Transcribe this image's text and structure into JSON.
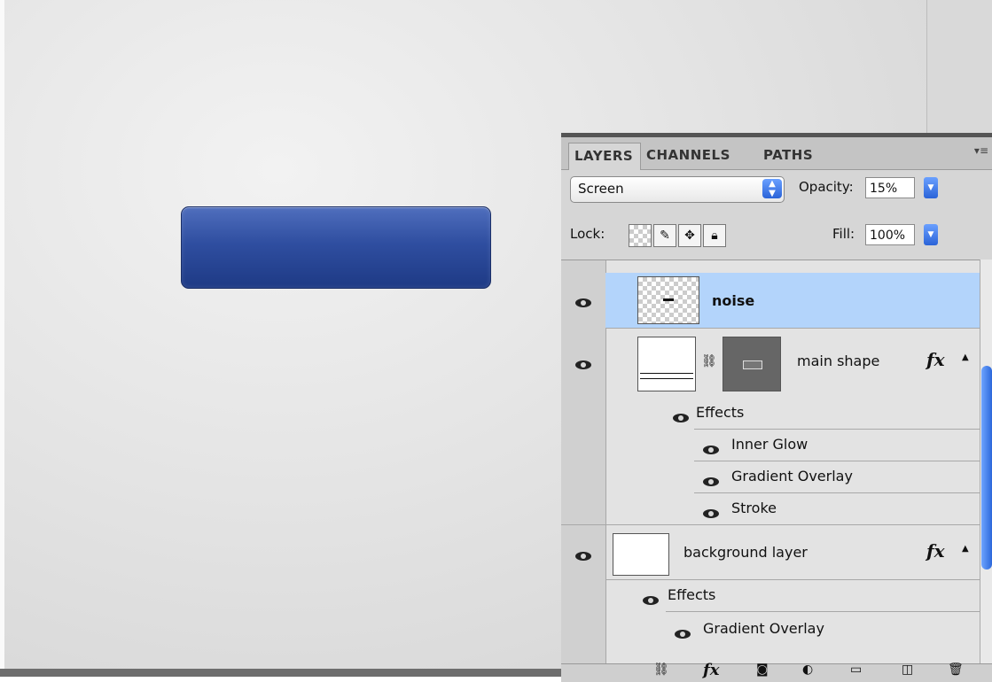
{
  "canvas": {
    "button_color": "#2f4ea0"
  },
  "layers_panel": {
    "tabs": [
      {
        "label": "LAYERS",
        "active": true
      },
      {
        "label": "CHANNELS",
        "active": false
      },
      {
        "label": "PATHS",
        "active": false
      }
    ],
    "blend_mode": "Screen",
    "opacity_label": "Opacity:",
    "opacity_value": "15%",
    "lock_label": "Lock:",
    "fill_label": "Fill:",
    "fill_value": "100%",
    "layers": [
      {
        "name": "noise",
        "selected": true
      },
      {
        "name": "main shape",
        "fx": "fx",
        "effects_label": "Effects",
        "effects": [
          "Inner Glow",
          "Gradient Overlay",
          "Stroke"
        ]
      },
      {
        "name": "background layer",
        "fx": "fx",
        "effects_label": "Effects",
        "effects": [
          "Gradient Overlay"
        ]
      }
    ],
    "footer_fx": "fx"
  }
}
